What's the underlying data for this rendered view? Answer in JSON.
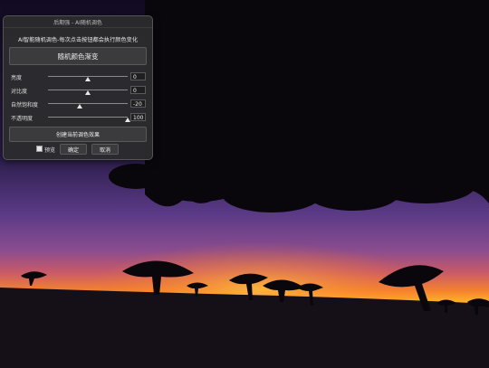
{
  "panel": {
    "title": "后期强 - AI随机调色",
    "description": "AI智能随机调色-每次点击按钮都会执行颜色变化",
    "random_button_label": "随机颜色渐变",
    "sliders": [
      {
        "label": "亮度",
        "value": "0",
        "level": 0.5
      },
      {
        "label": "对比度",
        "value": "0",
        "level": 0.5
      },
      {
        "label": "自然饱和度",
        "value": "-20",
        "level": 0.4
      },
      {
        "label": "不透明度",
        "value": "100",
        "level": 1.0
      }
    ],
    "snapshot_button_label": "创建当前调色效果",
    "preview_label": "预览",
    "preview_checked": true,
    "ok_label": "确定",
    "cancel_label": "取消"
  },
  "colors": {
    "sky_top": "#1a0f2e",
    "sky_mid": "#4a2a6e",
    "sky_glow": "#ff9a1e",
    "ground": "#150f18"
  }
}
